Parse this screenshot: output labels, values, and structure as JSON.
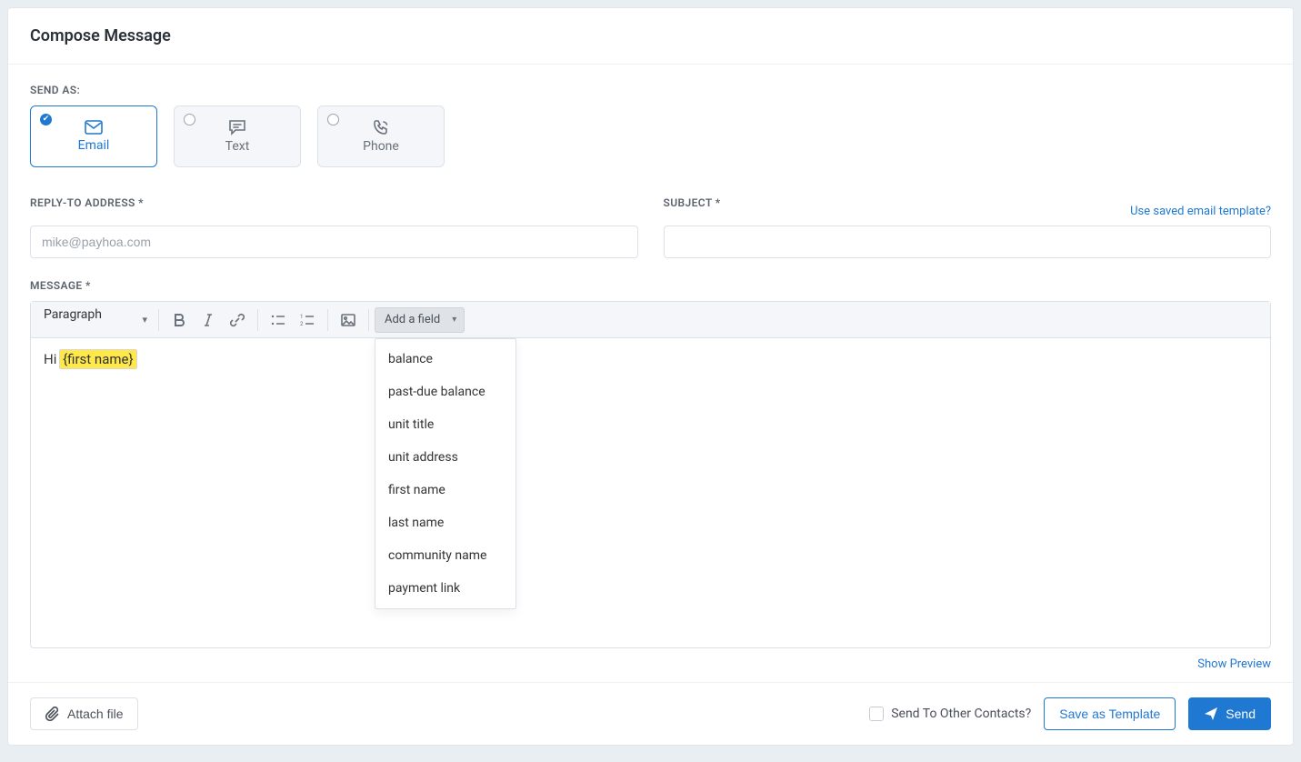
{
  "header": {
    "title": "Compose Message"
  },
  "send_as": {
    "label": "SEND AS:",
    "options": [
      {
        "key": "email",
        "label": "Email",
        "selected": true
      },
      {
        "key": "text",
        "label": "Text",
        "selected": false
      },
      {
        "key": "phone",
        "label": "Phone",
        "selected": false
      }
    ]
  },
  "reply_to": {
    "label": "REPLY-TO ADDRESS *",
    "placeholder": "mike@payhoa.com",
    "value": ""
  },
  "subject": {
    "label": "SUBJECT *",
    "value": "",
    "template_link": "Use saved email template?"
  },
  "message": {
    "label": "MESSAGE *",
    "format_value": "Paragraph",
    "add_field_label": "Add a field",
    "add_field_options": [
      "balance",
      "past-due balance",
      "unit title",
      "unit address",
      "first name",
      "last name",
      "community name",
      "payment link"
    ],
    "body_prefix": "Hi ",
    "body_merge_tag": "{first name}"
  },
  "preview": {
    "link": "Show Preview"
  },
  "footer": {
    "attach_label": "Attach file",
    "send_other_label": "Send To Other Contacts?",
    "save_template_label": "Save as Template",
    "send_label": "Send"
  }
}
